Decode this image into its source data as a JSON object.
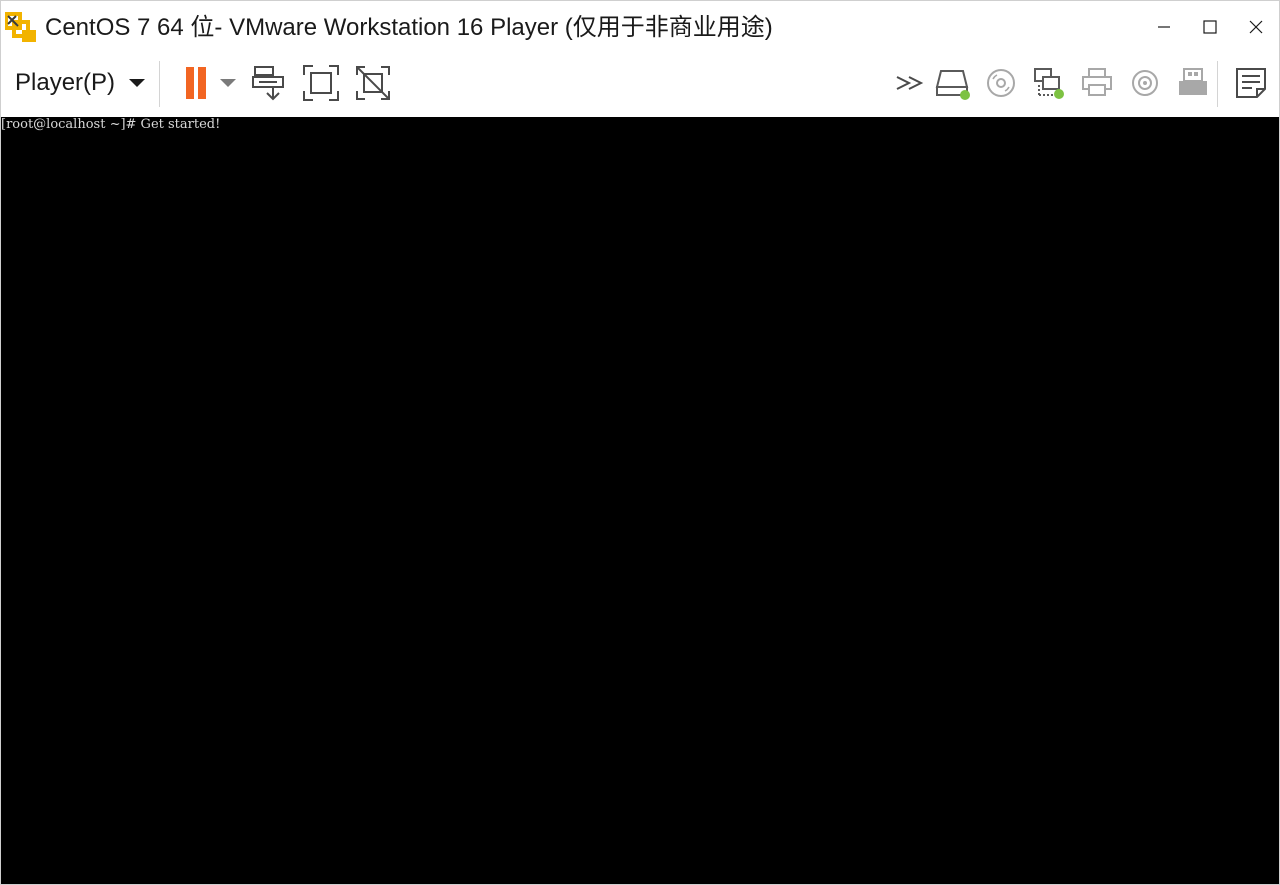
{
  "window": {
    "title": "CentOS 7 64 位- VMware Workstation 16 Player (仅用于非商业用途)",
    "controls": {
      "minimize": "minimize-icon",
      "maximize": "maximize-icon",
      "close": "close-icon"
    }
  },
  "toolbar": {
    "player_menu_label": "Player(P)",
    "accent_color": "#f26522",
    "buttons": [
      {
        "name": "pause-button",
        "icon": "pause-icon"
      },
      {
        "name": "pause-options-button",
        "icon": "chevron-down-icon"
      },
      {
        "name": "send-ctrl-alt-del-button",
        "icon": "send-keys-icon"
      },
      {
        "name": "fullscreen-button",
        "icon": "fullscreen-icon"
      },
      {
        "name": "unity-button",
        "icon": "unity-icon"
      }
    ],
    "devices": [
      {
        "name": "more-devices-button",
        "icon": "double-chevron-right-icon"
      },
      {
        "name": "hard-disk-device",
        "icon": "hard-disk-icon",
        "connected": true
      },
      {
        "name": "cd-dvd-device",
        "icon": "cd-icon",
        "connected": false
      },
      {
        "name": "network-adapter-device",
        "icon": "network-adapter-icon",
        "connected": true
      },
      {
        "name": "printer-device",
        "icon": "printer-icon",
        "connected": false
      },
      {
        "name": "sound-card-device",
        "icon": "speaker-icon",
        "connected": false
      },
      {
        "name": "usb-device",
        "icon": "usb-icon",
        "connected": false
      }
    ],
    "status_connected_color": "#7dc242",
    "notes_icon": "message-log-icon"
  },
  "console": {
    "line1": "[root@localhost ~]# Get started!"
  }
}
